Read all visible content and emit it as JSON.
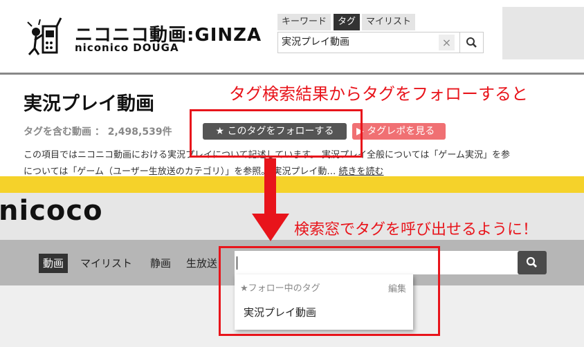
{
  "header": {
    "logo_main": "ニコニコ動画:GINZA",
    "logo_sub": "niconico DOUGA",
    "search_tabs": [
      "キーワード",
      "タグ",
      "マイリスト"
    ],
    "active_tab": "タグ",
    "search_value": "実況プレイ動画",
    "clear_icon": "×"
  },
  "tag_page": {
    "title": "実況プレイ動画",
    "count_label": "タグを含む動画 ： 2,498,539件",
    "follow_button": "★ このタグをフォローする",
    "repo_button": "▶ タグレポを見る",
    "description_line1": "この項目ではニコニコ動画における実況プレイについて記述しています。 実況プレイ全般については「ゲーム実況」を参",
    "description_line2": "については「ゲーム（ユーザー生放送のカテゴリ）」を参照。 実況プレイ動…",
    "read_more": "続きを読む"
  },
  "annotations": {
    "top": "タグ検索結果からタグをフォローすると",
    "bottom": "検索窓でタグを呼び出せるように！"
  },
  "new_header": {
    "logo": "nicoco",
    "nav": [
      "動画",
      "マイリスト",
      "静画",
      "生放送"
    ],
    "active_nav": "動画",
    "dropdown_heading": "★フォロー中のタグ",
    "dropdown_edit": "編集",
    "dropdown_items": [
      "実況プレイ動画"
    ]
  },
  "colors": {
    "accent_red": "#e8141b",
    "brand_yellow": "#f5d22a",
    "follow_button_bg": "#555555",
    "repo_button_bg": "#f07073"
  }
}
